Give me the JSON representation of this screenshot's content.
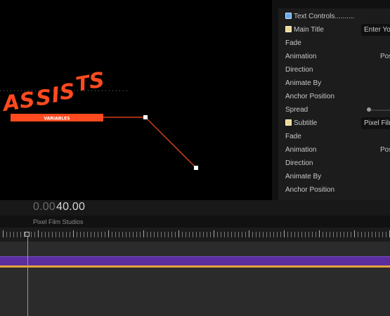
{
  "canvas": {
    "title_text": "ASSISTS",
    "subtitle_text": "VARIABLES",
    "accent_color": "#ff4a1f"
  },
  "inspector": {
    "rows": [
      {
        "label": "Text Controls",
        "icon": "checkbox-icon",
        "suffix": "..........",
        "value": ""
      },
      {
        "label": "Main Title",
        "icon": "note-icon",
        "value": "Enter Yo"
      },
      {
        "label": "Fade",
        "value": ""
      },
      {
        "label": "Animation",
        "value": "Pos"
      },
      {
        "label": "Direction",
        "value": ""
      },
      {
        "label": "Animate By",
        "value": ""
      },
      {
        "label": "Anchor Position",
        "value": ""
      },
      {
        "label": "Spread",
        "value": ""
      },
      {
        "label": "Subtitle",
        "icon": "note-icon",
        "value": "Pixel Film"
      },
      {
        "label": "Fade",
        "value": ""
      },
      {
        "label": "Animation",
        "value": "Pos"
      },
      {
        "label": "Direction",
        "value": ""
      },
      {
        "label": "Animate By",
        "value": ""
      },
      {
        "label": "Anchor Position",
        "value": ""
      }
    ]
  },
  "timeline": {
    "timecode_prefix": "0.00",
    "timecode_main": "40.00",
    "project_name": "Pixel Film Studios",
    "clip_color": "#5b2d9e",
    "clip_border_color": "#e5a53a"
  }
}
